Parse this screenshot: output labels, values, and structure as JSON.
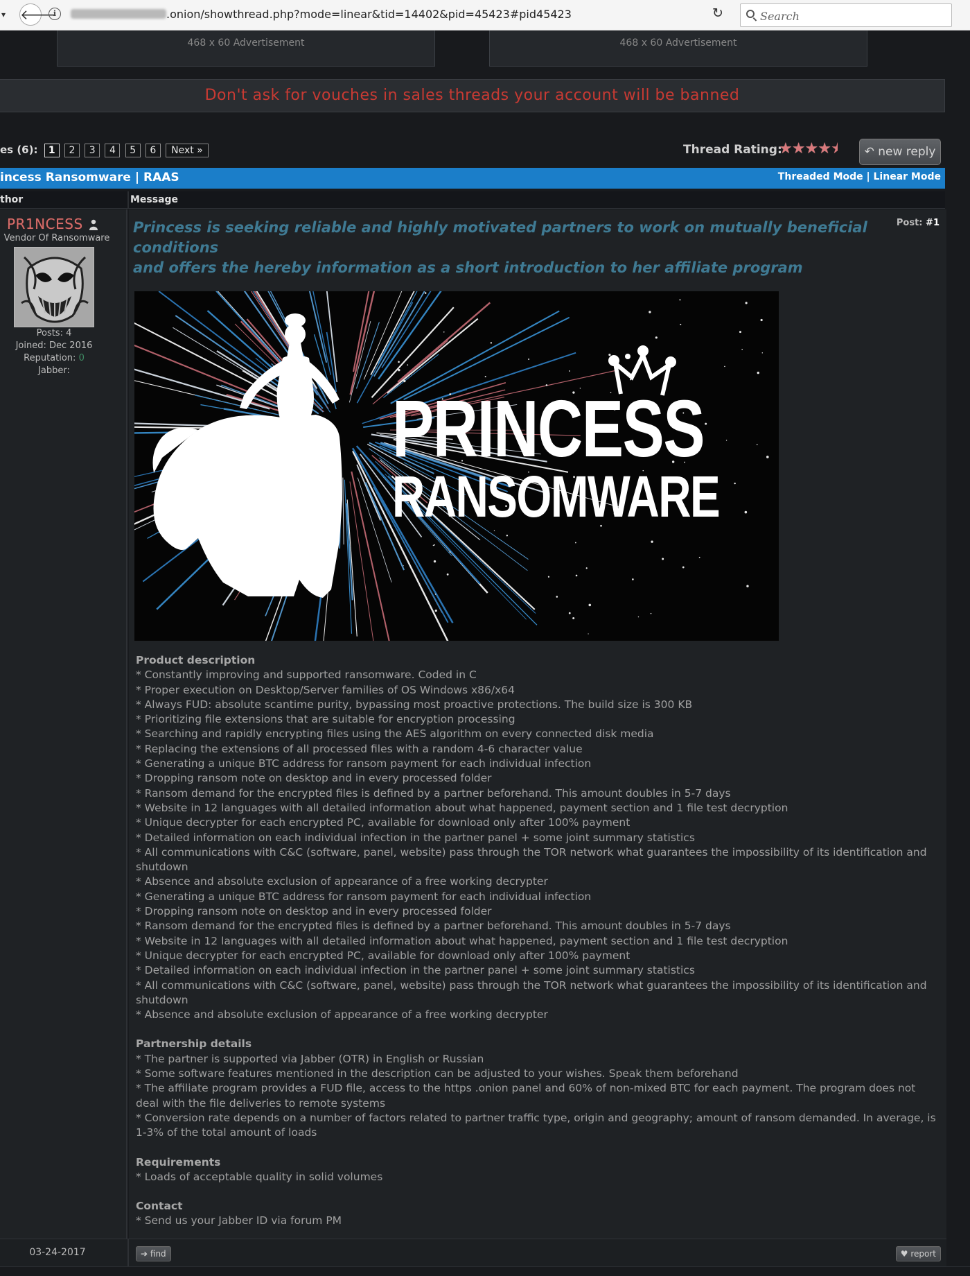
{
  "browser": {
    "url_visible": ".onion/showthread.php?mode=linear&tid=14402&pid=45423#pid45423",
    "search_placeholder": "Search"
  },
  "ads": {
    "left": "468 x 60 Advertisement",
    "right": "468 x 60 Advertisement"
  },
  "notice": "Don't ask for vouches in sales threads your account will be banned",
  "pagination": {
    "label": "es (6):",
    "pages": [
      "1",
      "2",
      "3",
      "4",
      "5",
      "6"
    ],
    "current": "1",
    "next": "Next »"
  },
  "rating": {
    "label": "Thread Rating:",
    "value": 4.5,
    "max": 5
  },
  "new_reply_label": "new reply",
  "thread": {
    "title": "incess Ransomware | RAAS",
    "mode_threaded": "Threaded Mode",
    "mode_separator": "|",
    "mode_linear": "Linear Mode"
  },
  "columns": {
    "author": "thor",
    "message": "Message"
  },
  "post": {
    "author": {
      "username": "PR1NCESS",
      "title": "Vendor Of Ransomware",
      "posts_label": "Posts:",
      "posts": "4",
      "joined_label": "Joined:",
      "joined": "Dec 2016",
      "reputation_label": "Reputation:",
      "reputation": "0",
      "jabber_label": "Jabber:"
    },
    "number_label": "Post:",
    "number": "#1",
    "heading_line1": "Princess is seeking reliable and highly motivated partners to work on mutually beneficial conditions",
    "heading_line2": "and offers the hereby information as a short introduction to her affiliate program",
    "banner": {
      "line1": "PRINCESS",
      "line2": "RANSOMWARE"
    },
    "sections": {
      "product": {
        "title": "Product description",
        "items": [
          "* Constantly improving and supported ransomware. Coded in C",
          "* Proper execution on Desktop/Server families of OS Windows x86/x64",
          "* Always FUD: absolute scantime purity, bypassing most proactive protections. The build size is 300 KB",
          "* Prioritizing file extensions that are suitable for encryption processing",
          "* Searching and rapidly encrypting files using the AES algorithm on every connected disk media",
          "* Replacing the extensions of all processed files with a random 4-6 character value",
          "* Generating a unique BTC address for ransom payment for each individual infection",
          "* Dropping ransom note on desktop and in every processed folder",
          "* Ransom demand for the encrypted files is defined by a partner beforehand. This amount doubles in 5-7 days",
          "* Website in 12 languages with all detailed information about what happened, payment section and 1 file test decryption",
          "* Unique decrypter for each encrypted PC, available for download only after 100% payment",
          "* Detailed information on each individual infection in the partner panel + some joint summary statistics",
          "* All communications with C&C (software, panel, website) pass through the TOR network what guarantees the impossibility of its identification and shutdown",
          "* Absence and absolute exclusion of appearance of a free working decrypter",
          "* Generating a unique BTC address for ransom payment for each individual infection",
          "* Dropping ransom note on desktop and in every processed folder",
          "* Ransom demand for the encrypted files is defined by a partner beforehand. This amount doubles in 5-7 days",
          "* Website in 12 languages with all detailed information about what happened, payment section and 1 file test decryption",
          "* Unique decrypter for each encrypted PC, available for download only after 100% payment",
          "* Detailed information on each individual infection in the partner panel + some joint summary statistics",
          "* All communications with C&C (software, panel, website) pass through the TOR network what guarantees the impossibility of its identification and shutdown",
          "* Absence and absolute exclusion of appearance of a free working decrypter"
        ]
      },
      "partnership": {
        "title": "Partnership details",
        "items": [
          "* The partner is supported via Jabber (OTR) in English or Russian",
          "* Some software features mentioned in the description can be adjusted to your wishes. Speak them beforehand",
          "* The affiliate program provides a FUD file, access to the https .onion panel and 60% of non-mixed BTC for each payment. The program does not deal with the file deliveries to remote systems",
          "* Conversion rate depends on a number of factors related to partner traffic type, origin and geography; amount of ransom demanded. In average, is 1-3% of the total amount of loads"
        ]
      },
      "requirements": {
        "title": "Requirements",
        "items": [
          "* Loads of acceptable quality in solid volumes"
        ]
      },
      "contact": {
        "title": "Contact",
        "items": [
          "* Send us your Jabber ID via forum PM"
        ]
      }
    },
    "date": "03-24-2017",
    "find_label": "find",
    "report_label": "report"
  },
  "colors": {
    "notice_red": "#c83a33",
    "thread_header_blue": "#1b7ec9",
    "username": "#d66d6a",
    "heading_teal": "#3f7a93"
  }
}
